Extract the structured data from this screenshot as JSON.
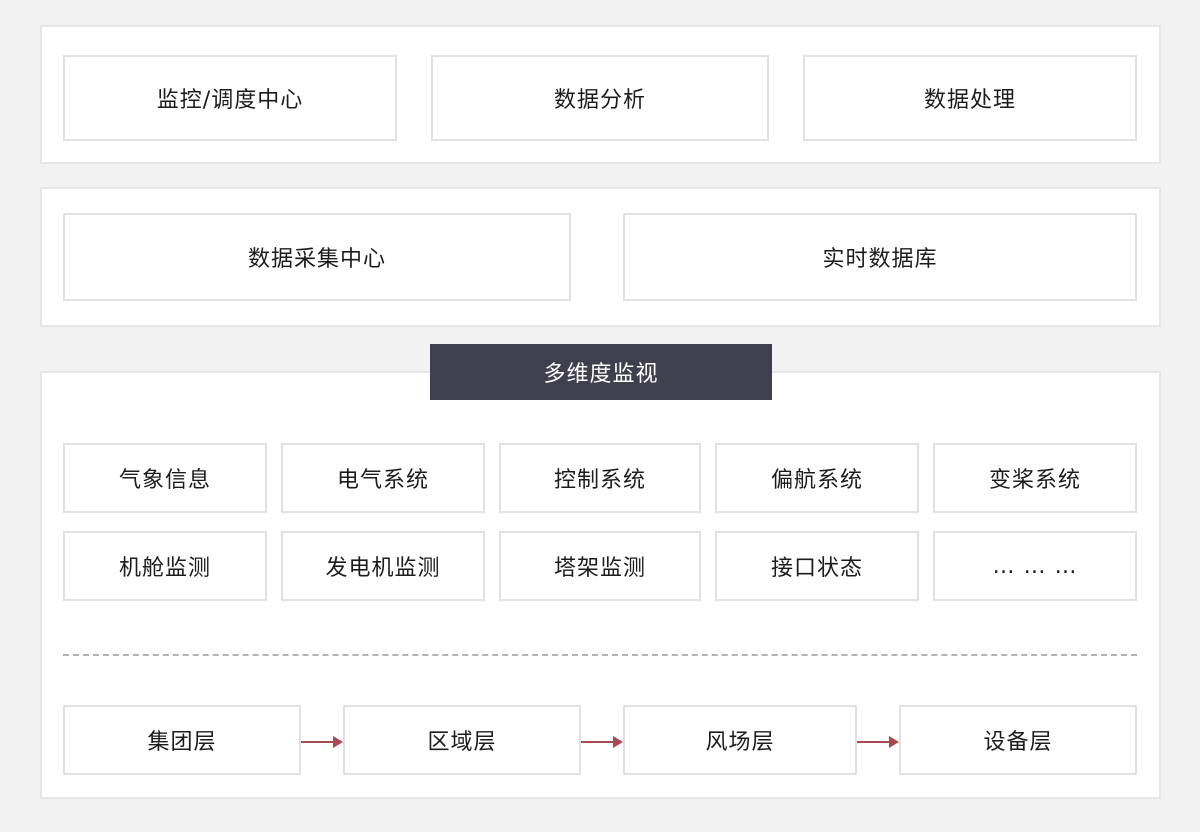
{
  "top_row": {
    "items": [
      "监控/调度中心",
      "数据分析",
      "数据处理"
    ]
  },
  "second_row": {
    "items": [
      "数据采集中心",
      "实时数据库"
    ]
  },
  "monitor": {
    "title": "多维度监视",
    "grid_row1": [
      "气象信息",
      "电气系统",
      "控制系统",
      "偏航系统",
      "变桨系统"
    ],
    "grid_row2": [
      "机舱监测",
      "发电机监测",
      "塔架监测",
      "接口状态",
      "… … …"
    ]
  },
  "hierarchy": {
    "levels": [
      "集团层",
      "区域层",
      "风场层",
      "设备层"
    ],
    "arrow_color": "#a84a50"
  },
  "colors": {
    "header_bg": "#403f4d",
    "page_bg": "#f2f2f3",
    "box_border": "#e1e1e4"
  }
}
